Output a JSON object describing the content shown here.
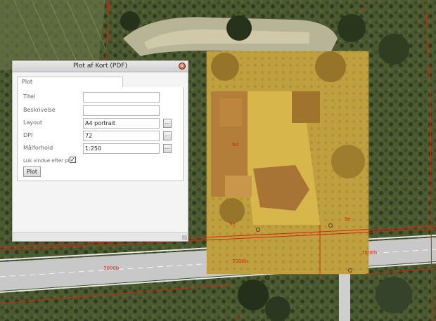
{
  "dialog": {
    "title": "Plot af Kort (PDF)",
    "close_icon": "close-icon",
    "tab_label": "Plot",
    "fields": {
      "titel": {
        "label": "Titel",
        "value": ""
      },
      "beskrivelse": {
        "label": "Beskrivelse",
        "value": ""
      },
      "layout": {
        "label": "Layout",
        "value": "A4 portrait",
        "button": "..."
      },
      "dpi": {
        "label": "DPI",
        "value": "72",
        "button": "..."
      },
      "scale": {
        "label": "Målforhold",
        "value": "1:250",
        "button": "..."
      }
    },
    "close_after_plot": {
      "label": "Luk vindue efter plot",
      "checked": true,
      "mark": "✓"
    },
    "plot_button": "Plot"
  },
  "map": {
    "plot_extent_color": "#e0a832",
    "parcel_line_color": "#d22810",
    "labels": {
      "road_left": "7000b",
      "road_mid": "7000b",
      "road_right": "7000b",
      "parcel_a": "6d",
      "parcel_b": "9e",
      "parcel_c": "9e",
      "top_a": "8e",
      "top_b": "8e",
      "bottom": "8e"
    }
  }
}
